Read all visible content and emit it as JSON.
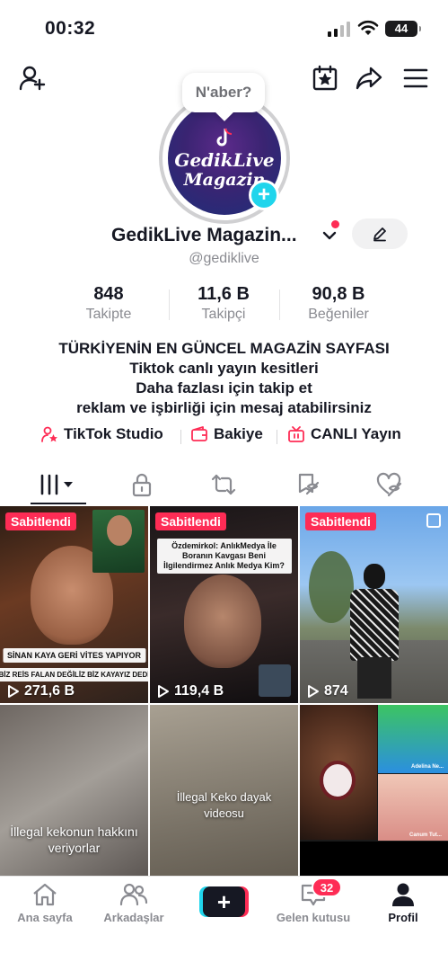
{
  "status_bar": {
    "time": "00:32",
    "battery": "44"
  },
  "header": {
    "bubble_text": "N'aber?",
    "avatar_text_line1": "GedikLive",
    "avatar_text_line2": "Magazin"
  },
  "profile": {
    "name": "GedikLive Magazin...",
    "username": "@gediklive",
    "stats": {
      "following_value": "848",
      "following_label": "Takipte",
      "followers_value": "11,6 B",
      "followers_label": "Takipçi",
      "likes_value": "90,8 B",
      "likes_label": "Beğeniler"
    },
    "bio_lines": [
      "TÜRKİYENİN EN GÜNCEL MAGAZİN SAYFASI",
      "Tiktok canlı yayın kesitleri",
      "Daha fazlası için takip et",
      "reklam ve işbirliği için mesaj atabilirsiniz"
    ]
  },
  "quick_links": {
    "studio": "TikTok Studio",
    "balance": "Bakiye",
    "live": "CANLI Yayın"
  },
  "videos": [
    {
      "pinned": "Sabitlendi",
      "views": "271,6 B",
      "caption1": "SİNAN KAYA GERİ VİTES YAPIYOR",
      "caption2": "BİZ REİS FALAN DEĞİLİZ BİZ KAYAYIZ DEDİ"
    },
    {
      "pinned": "Sabitlendi",
      "views": "119,4 B",
      "caption1": "Özdemirkol: AnlıkMedya İle Boranın Kavgası Beni İlgilendirmez Anlık Medya Kim?"
    },
    {
      "pinned": "Sabitlendi",
      "views": "874"
    },
    {
      "caption1": "İllegal kekonun hakkını veriyorlar"
    },
    {
      "caption1": "İllegal Keko dayak videosu"
    },
    {
      "label1": "Adelina Ne...",
      "label2": "Canum Tut..."
    }
  ],
  "bottom_nav": {
    "home": "Ana sayfa",
    "friends": "Arkadaşlar",
    "inbox": "Gelen kutusu",
    "inbox_badge": "32",
    "profile": "Profil"
  },
  "colors": {
    "accent": "#fe2c55",
    "cyan": "#20d5ec",
    "text": "#161823",
    "muted": "#8a8b91"
  }
}
